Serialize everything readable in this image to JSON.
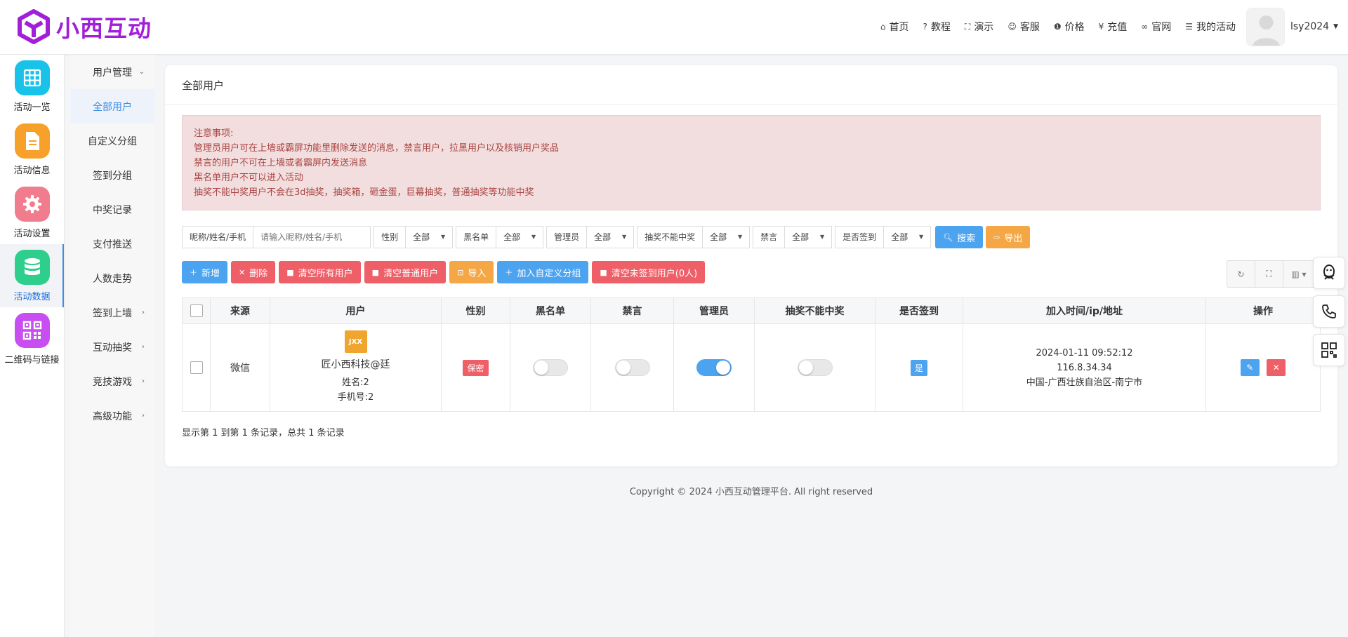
{
  "brand": {
    "name": "小西互动",
    "color": "#a21fd9"
  },
  "topnav": [
    {
      "icon": "home-icon",
      "glyph": "⌂",
      "label": "首页"
    },
    {
      "icon": "help-icon",
      "glyph": "?",
      "label": "教程"
    },
    {
      "icon": "fullscreen-icon",
      "glyph": "⛶",
      "label": "演示"
    },
    {
      "icon": "smile-icon",
      "glyph": "☺",
      "label": "客服"
    },
    {
      "icon": "info-icon",
      "glyph": "❶",
      "label": "价格"
    },
    {
      "icon": "yen-icon",
      "glyph": "¥",
      "label": "充值"
    },
    {
      "icon": "link-icon",
      "glyph": "∞",
      "label": "官网"
    },
    {
      "icon": "list-icon",
      "glyph": "☰",
      "label": "我的活动"
    }
  ],
  "user": {
    "name": "lsy2024"
  },
  "rail": [
    {
      "label": "活动一览",
      "color": "#19c2e8",
      "icon": "grid-icon"
    },
    {
      "label": "活动信息",
      "color": "#f7a12b",
      "icon": "document-icon"
    },
    {
      "label": "活动设置",
      "color": "#f17c8d",
      "icon": "gear-icon"
    },
    {
      "label": "活动数据",
      "color": "#2ecf8c",
      "icon": "database-icon"
    },
    {
      "label": "二维码与链接",
      "color": "#c84ef2",
      "icon": "qrcode-icon"
    }
  ],
  "submenu": [
    {
      "label": "用户管理",
      "arrow": "⌄"
    },
    {
      "label": "全部用户",
      "arrow": ""
    },
    {
      "label": "自定义分组",
      "arrow": ""
    },
    {
      "label": "签到分组",
      "arrow": ""
    },
    {
      "label": "中奖记录",
      "arrow": ""
    },
    {
      "label": "支付推送",
      "arrow": ""
    },
    {
      "label": "人数走势",
      "arrow": ""
    },
    {
      "label": "签到上墙",
      "arrow": "›"
    },
    {
      "label": "互动抽奖",
      "arrow": "›"
    },
    {
      "label": "竞技游戏",
      "arrow": "›"
    },
    {
      "label": "高级功能",
      "arrow": "›"
    }
  ],
  "page": {
    "title": "全部用户"
  },
  "notice": {
    "lines": [
      "注意事项:",
      "管理员用户可在上墙或霸屏功能里删除发送的消息，禁言用户，拉黑用户以及核销用户奖品",
      "禁言的用户不可在上墙或者霸屏内发送消息",
      "黑名单用户不可以进入活动",
      "抽奖不能中奖用户不会在3d抽奖，抽奖箱，砸金蛋，巨幕抽奖，普通抽奖等功能中奖"
    ]
  },
  "filters": {
    "keyword_label": "昵称/姓名/手机",
    "keyword_placeholder": "请输入昵称/姓名/手机",
    "selects": [
      {
        "label": "性别",
        "value": "全部"
      },
      {
        "label": "黑名单",
        "value": "全部"
      },
      {
        "label": "管理员",
        "value": "全部"
      },
      {
        "label": "抽奖不能中奖",
        "value": "全部"
      },
      {
        "label": "禁言",
        "value": "全部"
      },
      {
        "label": "是否签到",
        "value": "全部"
      }
    ],
    "search_label": "搜索",
    "export_label": "导出"
  },
  "toolbar": {
    "add": "新增",
    "delete": "删除",
    "clear_all": "清空所有用户",
    "clear_normal": "清空普通用户",
    "import": "导入",
    "add_group": "加入自定义分组",
    "clear_unsigned": "清空未签到用户(0人)"
  },
  "table": {
    "headers": [
      "来源",
      "用户",
      "性别",
      "黑名单",
      "禁言",
      "管理员",
      "抽奖不能中奖",
      "是否签到",
      "加入时间/ip/地址",
      "操作"
    ],
    "rows": [
      {
        "source": "微信",
        "avatar_text": "JXX",
        "nickname": "匠小西科技@廷",
        "name": "姓名:2",
        "phone": "手机号:2",
        "gender": "保密",
        "blacklist": false,
        "muted": false,
        "admin": true,
        "no_prize": false,
        "signed": "是",
        "time": "2024-01-11 09:52:12",
        "ip": "116.8.34.34",
        "address": "中国-广西壮族自治区-南宁市"
      }
    ]
  },
  "pagination": {
    "info": "显示第 1 到第 1 条记录，总共 1 条记录"
  },
  "footer": {
    "text": "Copyright © 2024 小西互动管理平台. All right reserved"
  },
  "colors": {
    "primary": "#4ca3f0",
    "danger": "#ee5f67",
    "warning": "#f4a744"
  }
}
